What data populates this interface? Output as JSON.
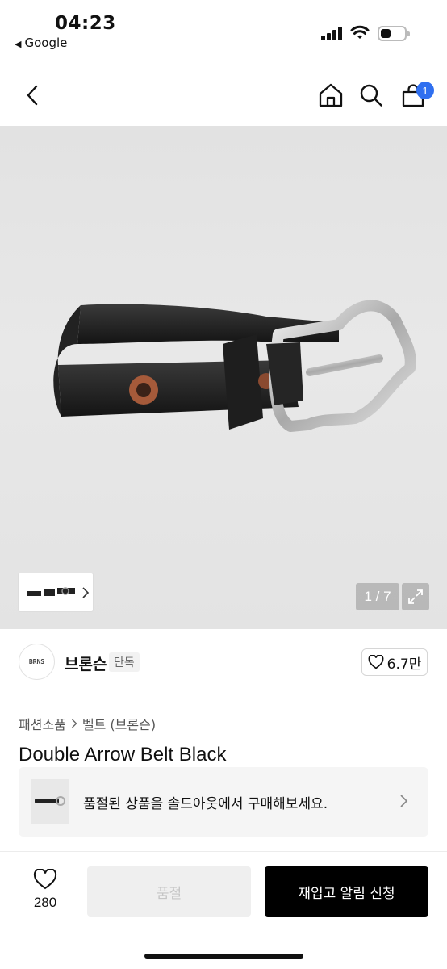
{
  "status_bar": {
    "time": "04:23",
    "back_app": "Google"
  },
  "header": {
    "cart_count": "1"
  },
  "gallery": {
    "counter": "1 / 7"
  },
  "brand": {
    "logo_text": "BRNS",
    "name": "브론슨",
    "tag": "단독",
    "likes": "6.7만"
  },
  "breadcrumb": {
    "category": "패션소품",
    "subcategory": "벨트 (브론슨)"
  },
  "product": {
    "title": "Double Arrow Belt Black"
  },
  "soldout_banner": {
    "text": "품절된 상품을 솔드아웃에서 구매해보세요."
  },
  "bottom_bar": {
    "like_count": "280",
    "soldout_label": "품절",
    "restock_label": "재입고 알림 신청"
  },
  "colors": {
    "accent": "#2f6ff0",
    "primary_button": "#000000"
  }
}
